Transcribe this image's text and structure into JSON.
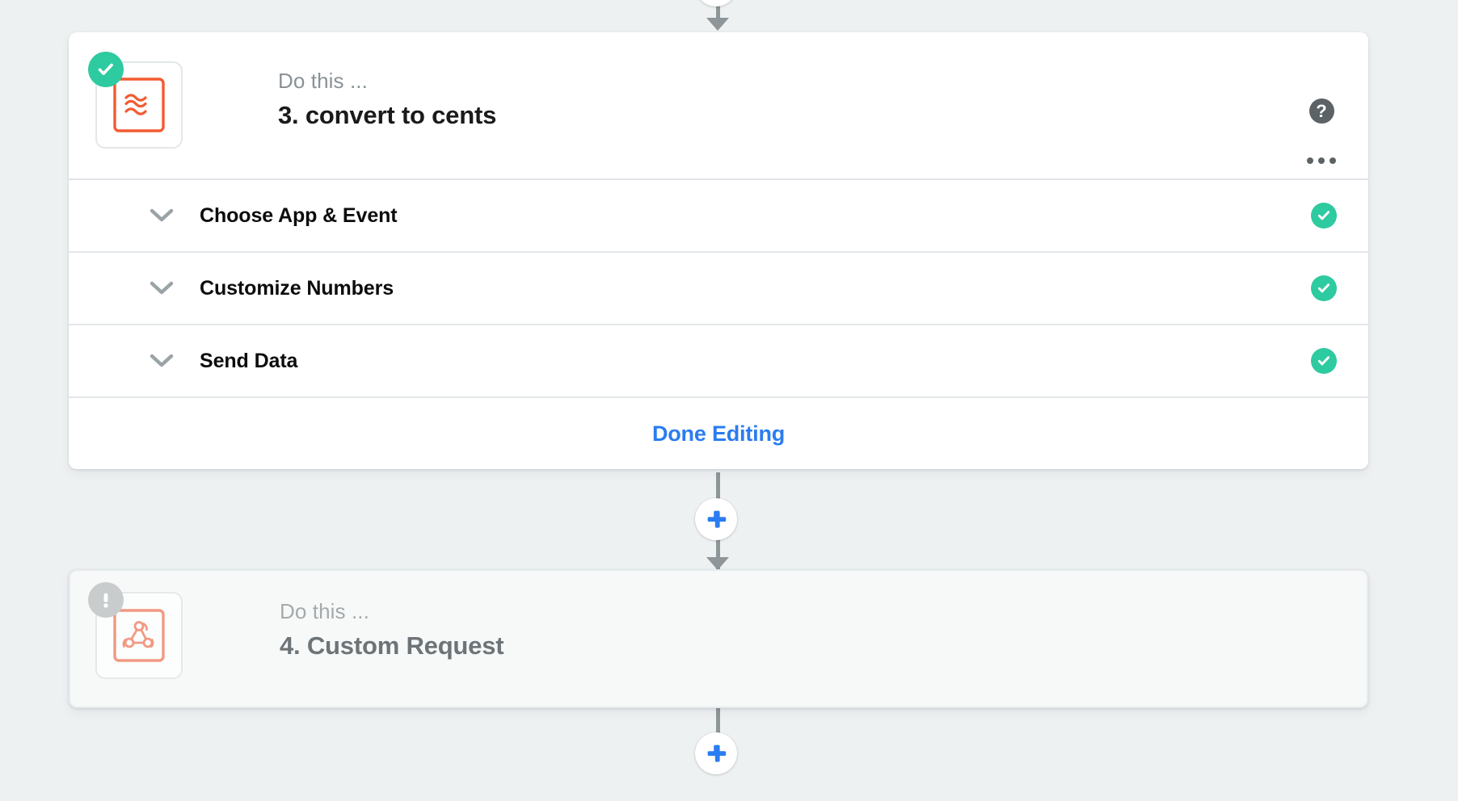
{
  "theme": {
    "page_background": "#eef1f2",
    "card_background": "#ffffff",
    "pending_card_background": "#f7f9f9",
    "accent_blue": "#2b7cf0",
    "success_green": "#2ecaa0",
    "warning_gray": "#c9cccd",
    "app_icon_orange": "#f25b31",
    "app_icon_orange_muted": "#f19982",
    "connector_gray": "#8e9699",
    "divider_gray": "#e3e7ea",
    "muted_text": "#8a9296",
    "title_text": "#1a1a1a",
    "disabled_title_text": "#6d7477"
  },
  "connectors": {
    "top_arrow_name": "connector-arrow-into-step-3",
    "mid_arrow_name": "connector-arrow-into-step-4",
    "add_step_icon": "plus-icon"
  },
  "buttons": {
    "add_step_between_label": "+",
    "add_step_bottom_label": "+"
  },
  "active_step": {
    "eyebrow": "Do this ...",
    "title": "3. convert to cents",
    "status_badge": {
      "icon": "check-icon",
      "state": "complete"
    },
    "app_icon": "formatter-waves-icon",
    "help_icon_label": "?",
    "more_menu_icon": "ellipsis-icon",
    "sections": [
      {
        "label": "Choose App & Event",
        "status_icon": "check-circle-icon",
        "expanded": false
      },
      {
        "label": "Customize Numbers",
        "status_icon": "check-circle-icon",
        "expanded": false
      },
      {
        "label": "Send Data",
        "status_icon": "check-circle-icon",
        "expanded": false
      }
    ],
    "done_button_label": "Done Editing"
  },
  "pending_step": {
    "eyebrow": "Do this ...",
    "title": "4. Custom Request",
    "status_badge": {
      "icon": "exclamation-icon",
      "state": "incomplete"
    },
    "app_icon": "webhooks-icon"
  }
}
